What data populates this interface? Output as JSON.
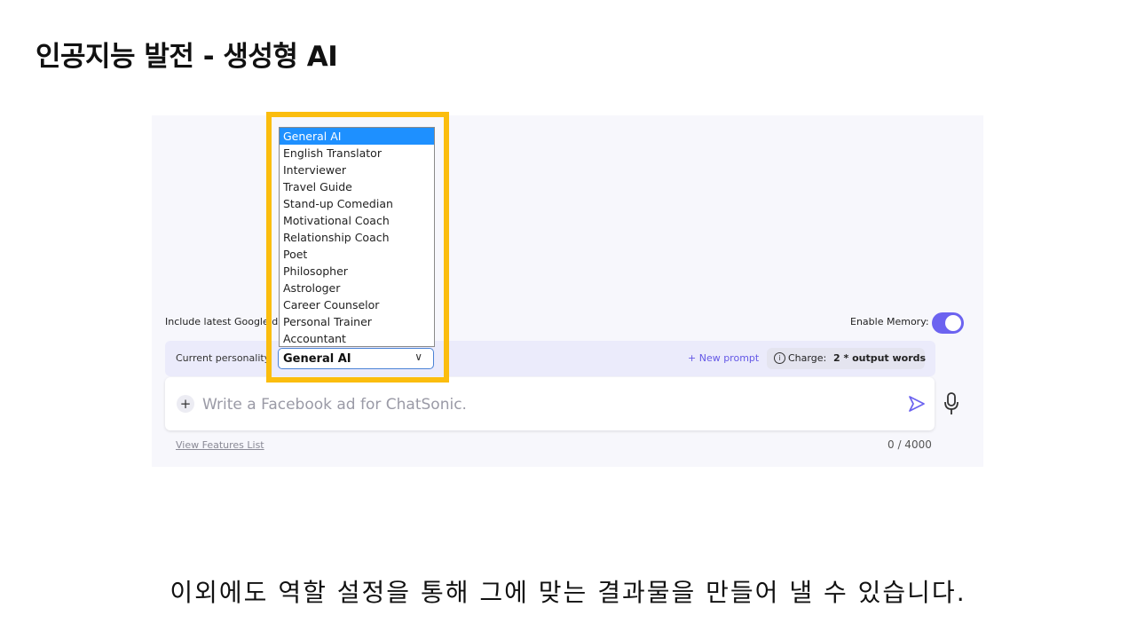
{
  "slide": {
    "title": "인공지능 발전 - 생성형 AI",
    "caption": "이외에도 역할 설정을 통해 그에 맞는 결과물을 만들어 낼 수 있습니다."
  },
  "chat_panel": {
    "include_google_label": "Include latest Google da",
    "enable_memory_label": "Enable Memory:",
    "memory_enabled": true,
    "current_personality_label": "Current personality",
    "personality_selected": "General AI",
    "new_prompt_label": "+ New prompt",
    "charge_label": "Charge:",
    "charge_value": "2 * output words",
    "input_placeholder": "Write a Facebook ad for ChatSonic.",
    "plus_symbol": "+",
    "info_symbol": "i",
    "view_features_label": "View Features List",
    "char_count": "0 / 4000",
    "accent_color": "#6c63f0"
  },
  "personality_dropdown": {
    "options": [
      "General AI",
      "English Translator",
      "Interviewer",
      "Travel Guide",
      "Stand-up Comedian",
      "Motivational Coach",
      "Relationship Coach",
      "Poet",
      "Philosopher",
      "Astrologer",
      "Career Counselor",
      "Personal Trainer",
      "Accountant"
    ],
    "selected_index": 0,
    "highlight_color": "#fbbd0e",
    "selection_color": "#1e90ff"
  },
  "icons": {
    "plus": "plus-icon",
    "send": "send-icon",
    "mic": "microphone-icon",
    "chevron": "chevron-down-icon",
    "info": "info-icon"
  }
}
